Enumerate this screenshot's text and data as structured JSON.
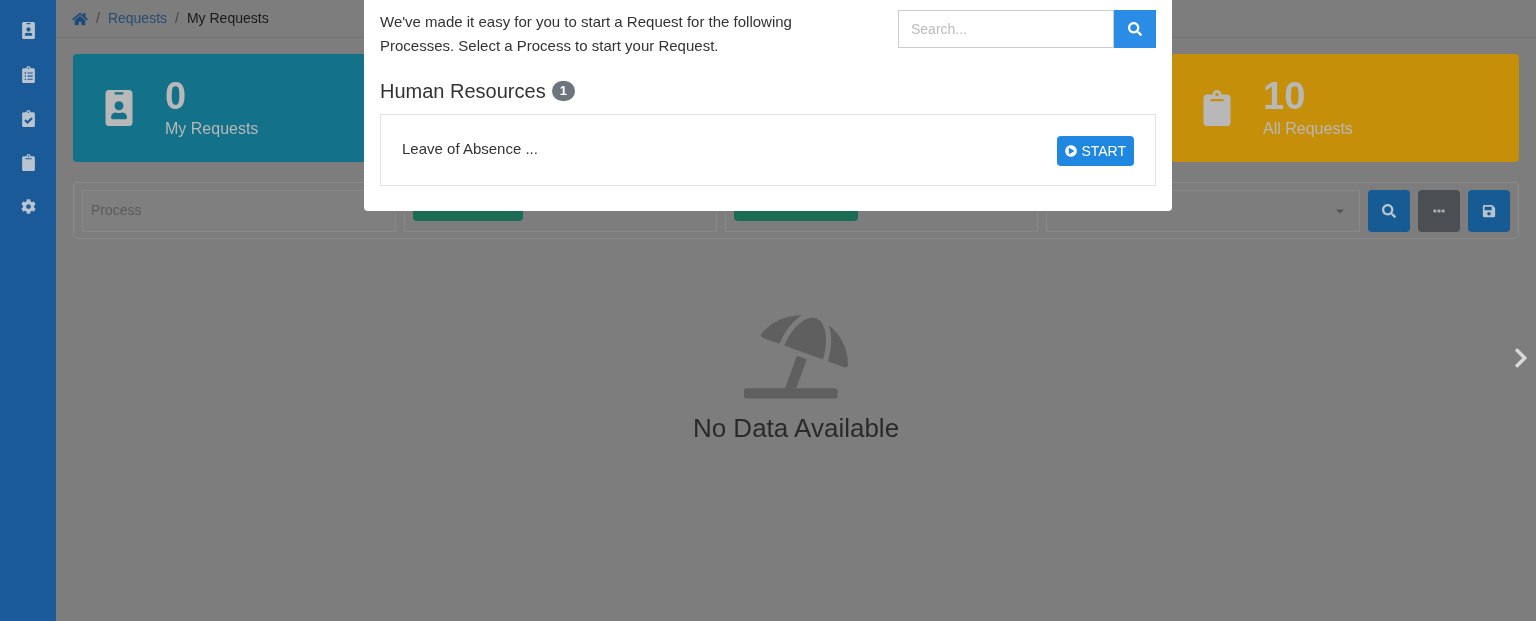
{
  "sidebar": {
    "items": [
      {
        "kind": "badge",
        "selected": false
      },
      {
        "kind": "list",
        "selected": false
      },
      {
        "kind": "check",
        "selected": false
      },
      {
        "kind": "clipboard",
        "selected": false
      },
      {
        "kind": "settings",
        "selected": false
      }
    ]
  },
  "breadcrumb": [
    {
      "separator": "/",
      "label": "Requests"
    },
    {
      "separator": "/",
      "label": "My Requests"
    }
  ],
  "cards": [
    {
      "kind": "badge",
      "count": "0",
      "label": "My Requests",
      "color": "#137189"
    },
    {
      "kind": "clipboard",
      "count": "10",
      "label": "All Requests",
      "color": "#c58f0a"
    }
  ],
  "filters": {
    "process_placeholder": "Process"
  },
  "empty_state": {
    "text": "No Data Available"
  },
  "modal": {
    "intro": "We've made it easy for you to start a Request for the following Processes. Select a Process to start your Request.",
    "search_placeholder": "Search...",
    "category": {
      "name": "Human Resources",
      "count": "1",
      "processes": [
        {
          "name": "Leave of Absence ...",
          "button": "START"
        }
      ]
    }
  }
}
